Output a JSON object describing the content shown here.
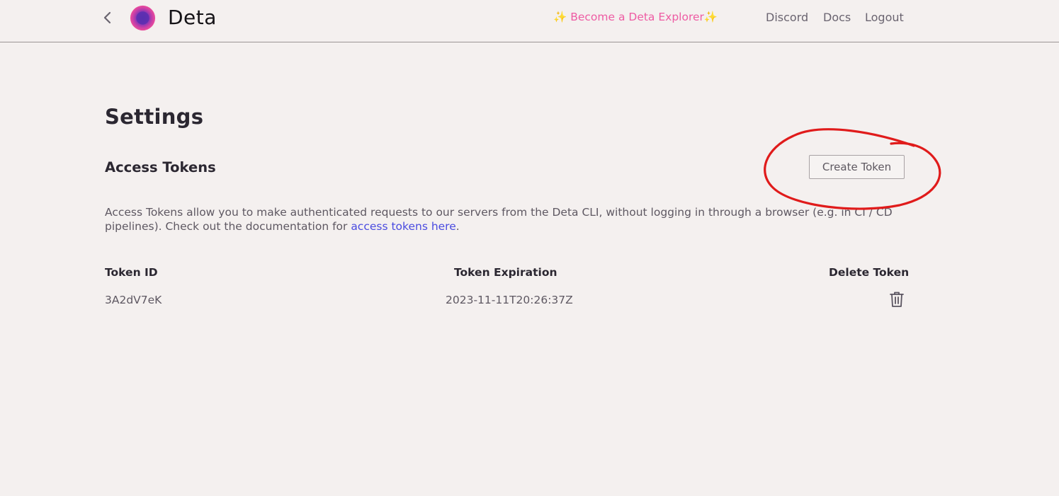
{
  "header": {
    "brand": "Deta",
    "explorer_cta": "✨ Become a Deta Explorer✨",
    "nav": [
      "Discord",
      "Docs",
      "Logout"
    ]
  },
  "settings": {
    "title": "Settings",
    "section_title": "Access Tokens",
    "create_button": "Create Token",
    "description_text": "Access Tokens allow you to make authenticated requests to our servers from the Deta CLI, without logging in through a browser (e.g. in CI / CD pipelines). Check out the documentation for ",
    "description_link": "access tokens here",
    "description_end": "."
  },
  "tokens_table": {
    "columns": [
      "Token ID",
      "Token Expiration",
      "Delete Token"
    ],
    "rows": [
      {
        "id": "3A2dV7eK",
        "expiration": "2023-11-11T20:26:37Z"
      }
    ]
  },
  "colors": {
    "background": "#f4f0ef",
    "cta_pink": "#ee5ba3",
    "link_blue": "#4a4be0",
    "annotation_red": "#e01b1b"
  },
  "icons": {
    "back": "chevron-left-icon",
    "logo": "deta-logo",
    "delete": "trash-icon"
  }
}
